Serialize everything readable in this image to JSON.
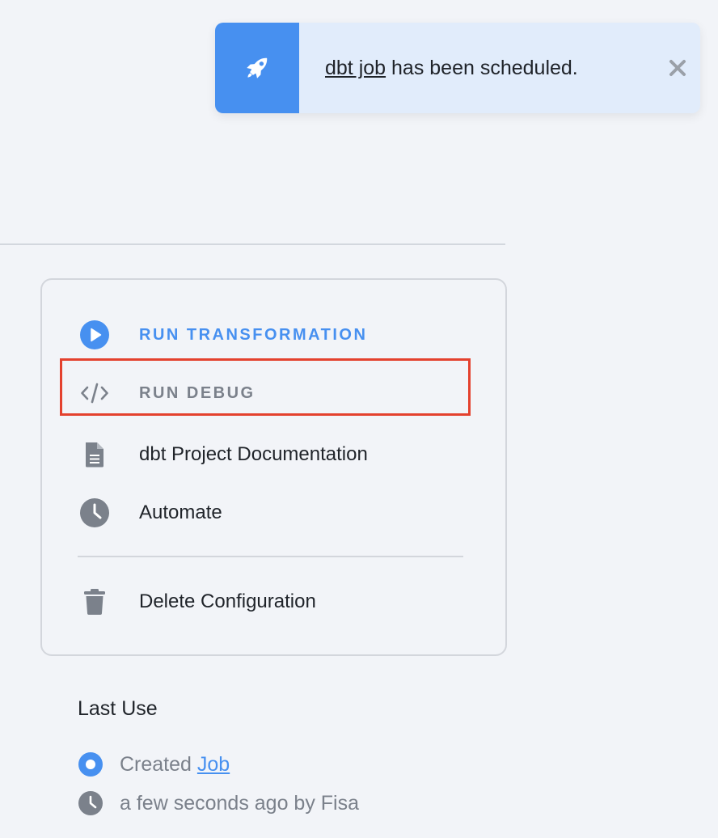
{
  "toast": {
    "link_text": "dbt job",
    "message": " has been scheduled.",
    "icon": "rocket-icon",
    "close_icon": "close-icon"
  },
  "menu": {
    "run_transformation": "RUN TRANSFORMATION",
    "run_debug": "RUN DEBUG",
    "documentation": "dbt Project Documentation",
    "automate": "Automate",
    "delete": "Delete Configuration"
  },
  "last_use": {
    "title": "Last Use",
    "created_prefix": "Created ",
    "created_link": "Job",
    "time_text": "a few seconds ago by Fisa"
  },
  "colors": {
    "accent": "#4790f0",
    "muted": "#7b818b",
    "highlight": "#e4412e",
    "toast_bg": "#e1ecfb"
  }
}
